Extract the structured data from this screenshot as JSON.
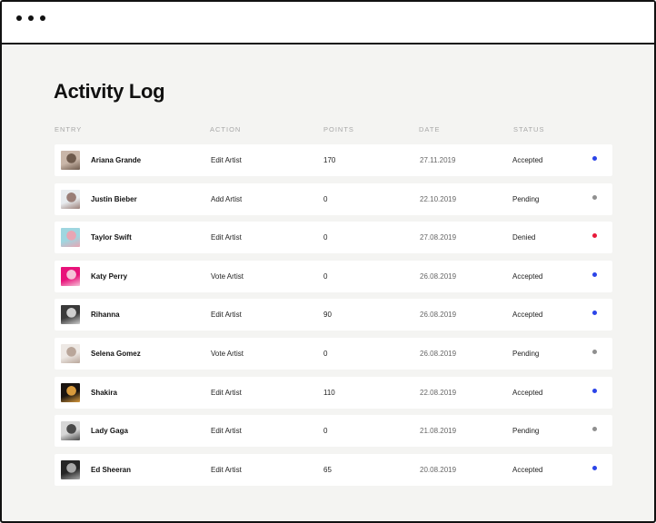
{
  "window": {
    "controls": [
      "dot-1",
      "dot-2",
      "dot-3"
    ]
  },
  "page": {
    "title": "Activity Log"
  },
  "table": {
    "columns": {
      "entry": "ENTRY",
      "action": "ACTION",
      "points": "POINTS",
      "date": "DATE",
      "status": "STATUS"
    },
    "rows": [
      {
        "name": "Ariana Grande",
        "action": "Edit Artist",
        "points": "170",
        "date": "27.11.2019",
        "status": "Accepted",
        "status_color": "#2b44e8",
        "thumb_colors": [
          "#c9b6a8",
          "#6e5a4c"
        ]
      },
      {
        "name": "Justin Bieber",
        "action": "Add Artist",
        "points": "0",
        "date": "22.10.2019",
        "status": "Pending",
        "status_color": "#8f8f8f",
        "thumb_colors": [
          "#e8ecef",
          "#9a7f78"
        ]
      },
      {
        "name": "Taylor Swift",
        "action": "Edit Artist",
        "points": "0",
        "date": "27.08.2019",
        "status": "Denied",
        "status_color": "#e8193a",
        "thumb_colors": [
          "#9fd6e0",
          "#e8a6b4"
        ]
      },
      {
        "name": "Katy Perry",
        "action": "Vote Artist",
        "points": "0",
        "date": "26.08.2019",
        "status": "Accepted",
        "status_color": "#2b44e8",
        "thumb_colors": [
          "#e8127a",
          "#f5c2d8"
        ]
      },
      {
        "name": "Rihanna",
        "action": "Edit Artist",
        "points": "90",
        "date": "26.08.2019",
        "status": "Accepted",
        "status_color": "#2b44e8",
        "thumb_colors": [
          "#3a3a3a",
          "#cfcfcf"
        ]
      },
      {
        "name": "Selena Gomez",
        "action": "Vote Artist",
        "points": "0",
        "date": "26.08.2019",
        "status": "Pending",
        "status_color": "#8f8f8f",
        "thumb_colors": [
          "#ede8e4",
          "#b9a69a"
        ]
      },
      {
        "name": "Shakira",
        "action": "Edit Artist",
        "points": "110",
        "date": "22.08.2019",
        "status": "Accepted",
        "status_color": "#2b44e8",
        "thumb_colors": [
          "#1a1410",
          "#d89a3c"
        ]
      },
      {
        "name": "Lady Gaga",
        "action": "Edit Artist",
        "points": "0",
        "date": "21.08.2019",
        "status": "Pending",
        "status_color": "#8f8f8f",
        "thumb_colors": [
          "#d6d6d6",
          "#4a4a4a"
        ]
      },
      {
        "name": "Ed Sheeran",
        "action": "Edit Artist",
        "points": "65",
        "date": "20.08.2019",
        "status": "Accepted",
        "status_color": "#2b44e8",
        "thumb_colors": [
          "#262626",
          "#a8a8a8"
        ]
      }
    ]
  }
}
